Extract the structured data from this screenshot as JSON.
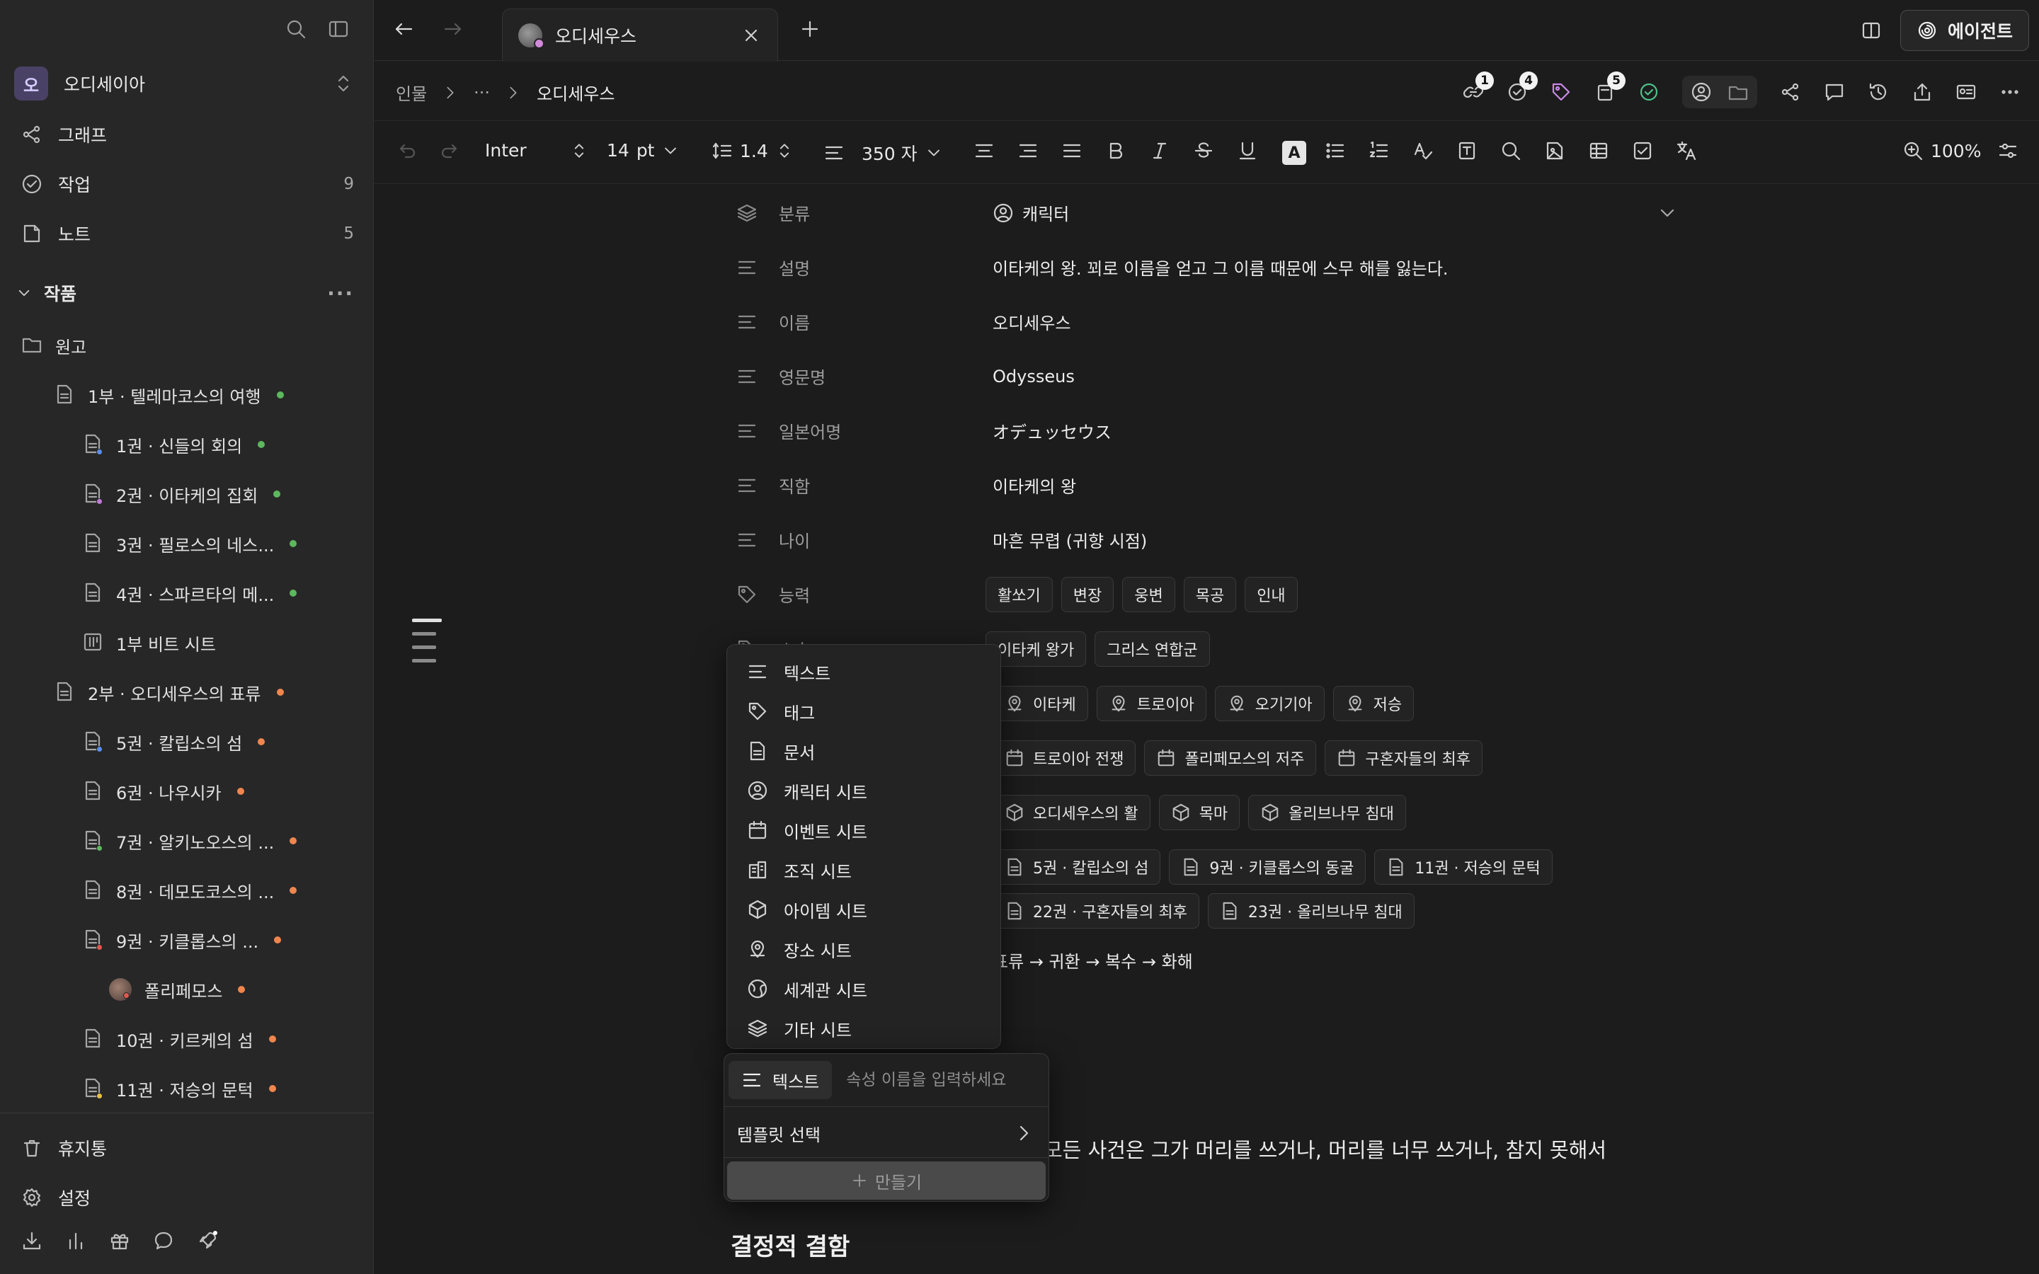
{
  "sidebar": {
    "workspace": {
      "initial": "오",
      "name": "오디세이아"
    },
    "nav": [
      {
        "label": "그래프",
        "count": ""
      },
      {
        "label": "작업",
        "count": "9"
      },
      {
        "label": "노트",
        "count": "5"
      }
    ],
    "section_title": "작품",
    "tree": [
      {
        "label": "원고",
        "icon": "folder-icon",
        "status": ""
      },
      {
        "label": "1부 · 텔레마코스의 여행",
        "icon": "document-icon",
        "status": "#5cb85c"
      },
      {
        "label": "1권 · 신들의 회의",
        "icon": "document-icon",
        "status": "#5cb85c",
        "sub": "#5b8def"
      },
      {
        "label": "2권 · 이타케의 집회",
        "icon": "document-icon",
        "status": "#5cb85c",
        "sub": "#c27bd8"
      },
      {
        "label": "3권 · 필로스의 네스...",
        "icon": "document-icon",
        "status": "#5cb85c"
      },
      {
        "label": "4권 · 스파르타의 메...",
        "icon": "document-icon",
        "status": "#5cb85c"
      },
      {
        "label": "1부 비트 시트",
        "icon": "beat-sheet-icon",
        "status": ""
      },
      {
        "label": "2부 · 오디세우스의 표류",
        "icon": "document-icon",
        "status": "#f0864d"
      },
      {
        "label": "5권 · 칼립소의 섬",
        "icon": "document-icon",
        "status": "#f0864d",
        "sub": "#5b8def"
      },
      {
        "label": "6권 · 나우시카",
        "icon": "document-icon",
        "status": "#f0864d"
      },
      {
        "label": "7권 · 알키노오스의 ...",
        "icon": "document-icon",
        "status": "#f0864d",
        "sub": "#5cb85c"
      },
      {
        "label": "8권 · 데모도코스의 ...",
        "icon": "document-icon",
        "status": "#f0864d"
      },
      {
        "label": "9권 · 키클롭스의 ...",
        "icon": "document-icon",
        "status": "#f0864d",
        "sub": "#e0584e"
      },
      {
        "label": "폴리페모스",
        "icon": "avatar-icon",
        "status": "#f0864d"
      },
      {
        "label": "10권 · 키르케의 섬",
        "icon": "document-icon",
        "status": "#f0864d"
      },
      {
        "label": "11권 · 저승의 문턱",
        "icon": "document-icon",
        "status": "#f0864d",
        "sub": "#e5c144"
      }
    ],
    "trash": "휴지통",
    "settings": "설정"
  },
  "tabbar": {
    "tab_title": "오디세우스",
    "agent": "에이전트"
  },
  "breadcrumb": {
    "root": "인물",
    "ellipsis": "···",
    "current": "오디세우스"
  },
  "badges": {
    "links": "1",
    "tasks": "4",
    "docs": "5"
  },
  "format": {
    "font": "Inter",
    "size": "14",
    "size_unit": "pt",
    "line_height": "1.4",
    "width": "350 자",
    "zoom": "100%"
  },
  "props": {
    "category": {
      "key": "분류",
      "value": "캐릭터"
    },
    "description": {
      "key": "설명",
      "value": "이타케의 왕. 꾀로 이름을 얻고 그 이름 때문에 스무 해를 잃는다."
    },
    "name": {
      "key": "이름",
      "value": "오디세우스"
    },
    "english": {
      "key": "영문명",
      "value": "Odysseus"
    },
    "japanese": {
      "key": "일본어명",
      "value": "オデュッセウス"
    },
    "title": {
      "key": "직함",
      "value": "이타케의 왕"
    },
    "age": {
      "key": "나이",
      "value": "마흔 무렵 (귀향 시점)"
    },
    "abilities": {
      "key": "능력",
      "tags": [
        "활쏘기",
        "변장",
        "웅변",
        "목공",
        "인내"
      ]
    },
    "affiliation": {
      "key": "소속",
      "tags": [
        "이타케 왕가",
        "그리스 연합군"
      ]
    },
    "places": [
      "이타케",
      "트로이아",
      "오기기아",
      "저승"
    ],
    "events": [
      "트로이아 전쟁",
      "폴리페모스의 저주",
      "구혼자들의 최후"
    ],
    "items": [
      "오디세우스의 활",
      "목마",
      "올리브나무 침대"
    ],
    "documents": [
      "5권 · 칼립소의 섬",
      "9권 · 키클롭스의 동굴",
      "11권 · 저승의 문턱",
      "22권 · 구혼자들의 최후",
      "23권 · 올리브나무 침대"
    ],
    "arc": "표류 → 귀환 → 복수 → 화해"
  },
  "type_menu": [
    "텍스트",
    "태그",
    "문서",
    "캐릭터 시트",
    "이벤트 시트",
    "조직 시트",
    "아이템 시트",
    "장소 시트",
    "세계관 시트",
    "기타 시트"
  ],
  "new_property": {
    "type": "텍스트",
    "placeholder": "속성 이름을 입력하세요",
    "template": "템플릿 선택",
    "create": "만들기"
  },
  "body": {
    "text": "모든 사건은 그가 머리를 쓰거나, 머리를 너무 쓰거나, 참지 못해서",
    "heading": "결정적 결함"
  }
}
